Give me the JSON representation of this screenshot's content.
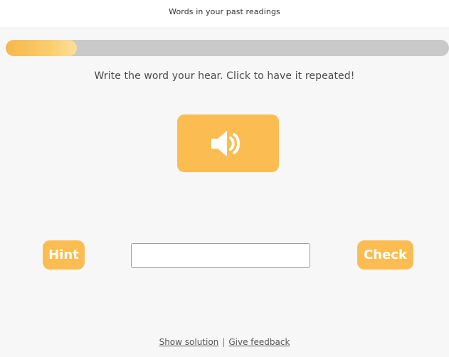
{
  "header": {
    "title": "Words in your past readings"
  },
  "progress": {
    "value_fraction": 0.16,
    "track_color": "#c9c9c9",
    "fill_color": "#fbbd52"
  },
  "exercise": {
    "instruction": "Write the word your hear. Click to have it repeated!",
    "sound_icon": "speaker-icon"
  },
  "controls": {
    "hint_label": "Hint",
    "check_label": "Check",
    "answer_value": "",
    "answer_placeholder": ""
  },
  "footer": {
    "show_solution": "Show solution",
    "separator": "|",
    "give_feedback": "Give feedback"
  },
  "colors": {
    "accent": "#fbbd52",
    "background": "#f7f7f7",
    "button_text": "#ffffff"
  }
}
